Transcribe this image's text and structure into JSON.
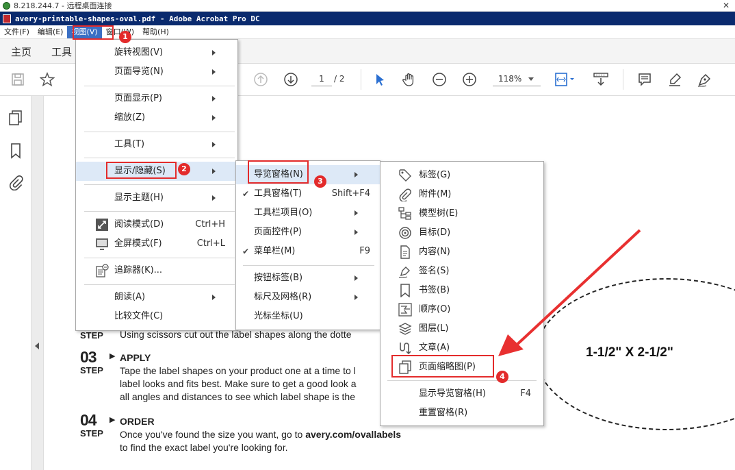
{
  "remote_desktop": {
    "title": "8.218.244.7 - 远程桌面连接",
    "close": "✕"
  },
  "window": {
    "title": "avery-printable-shapes-oval.pdf - Adobe Acrobat Pro DC"
  },
  "menubar": {
    "items": [
      "文件(F)",
      "编辑(E)",
      "视图(V)",
      "窗口(W)",
      "帮助(H)"
    ]
  },
  "tabs": {
    "home": "主页",
    "tools": "工具"
  },
  "toolbar": {
    "page_current": "1",
    "page_total": "/ 2",
    "zoom": "118%"
  },
  "view_menu": {
    "items": [
      {
        "label": "旋转视图(V)",
        "sub": true
      },
      {
        "label": "页面导览(N)",
        "sub": true
      },
      {
        "label": "页面显示(P)",
        "sub": true
      },
      {
        "label": "缩放(Z)",
        "sub": true
      },
      {
        "label": "工具(T)",
        "sub": true
      },
      {
        "label": "显示/隐藏(S)",
        "sub": true
      },
      {
        "label": "显示主题(H)",
        "sub": true
      },
      {
        "label": "阅读模式(D)",
        "shortcut": "Ctrl+H",
        "icon": "reading-mode-icon"
      },
      {
        "label": "全屏模式(F)",
        "shortcut": "Ctrl+L",
        "icon": "fullscreen-icon"
      },
      {
        "label": "追踪器(K)...",
        "icon": "tracker-icon"
      },
      {
        "label": "朗读(A)",
        "sub": true
      },
      {
        "label": "比较文件(C)"
      }
    ]
  },
  "showhide_menu": {
    "items": [
      {
        "label": "导览窗格(N)",
        "sub": true
      },
      {
        "label": "工具窗格(T)",
        "shortcut": "Shift+F4",
        "checked": true
      },
      {
        "label": "工具栏项目(O)",
        "sub": true
      },
      {
        "label": "页面控件(P)",
        "sub": true
      },
      {
        "label": "菜单栏(M)",
        "shortcut": "F9",
        "checked": true
      },
      {
        "label": "按钮标签(B)",
        "sub": true
      },
      {
        "label": "标尺及网格(R)",
        "sub": true
      },
      {
        "label": "光标坐标(U)"
      }
    ]
  },
  "nav_menu": {
    "items": [
      {
        "label": "标签(G)",
        "icon": "tag-icon"
      },
      {
        "label": "附件(M)",
        "icon": "paperclip-icon"
      },
      {
        "label": "模型树(E)",
        "icon": "model-tree-icon"
      },
      {
        "label": "目标(D)",
        "icon": "target-icon"
      },
      {
        "label": "内容(N)",
        "icon": "content-icon"
      },
      {
        "label": "签名(S)",
        "icon": "signature-icon"
      },
      {
        "label": "书签(B)",
        "icon": "bookmark-icon"
      },
      {
        "label": "顺序(O)",
        "icon": "order-icon"
      },
      {
        "label": "图层(L)",
        "icon": "layers-icon"
      },
      {
        "label": "文章(A)",
        "icon": "article-icon"
      },
      {
        "label": "页面缩略图(P)",
        "icon": "page-thumbnail-icon"
      },
      {
        "label": "显示导览窗格(H)",
        "shortcut": "F4"
      },
      {
        "label": "重置窗格(R)"
      }
    ]
  },
  "annotations": {
    "badges": [
      "1",
      "2",
      "3",
      "4"
    ]
  },
  "document": {
    "step02_label": "STEP",
    "step02_text": "Using scissors cut out the label shapes along the dotte",
    "step03_num": "03",
    "step03_label": "STEP",
    "step03_title": "APPLY",
    "step03_line1": "Tape the label shapes on your product one at a time to l",
    "step03_line2": "label looks and fits best. Make sure to get a good look a",
    "step03_line3": "all angles and distances to see which label shape is the",
    "step04_num": "04",
    "step04_label": "STEP",
    "step04_title": "ORDER",
    "step04_line1_prefix": "Once you've found the size you want, go to ",
    "step04_link": "avery.com/ovallabels",
    "step04_line2": "to find the exact label you're looking for.",
    "oval_label": "1-1/2\" X 2-1/2\""
  }
}
